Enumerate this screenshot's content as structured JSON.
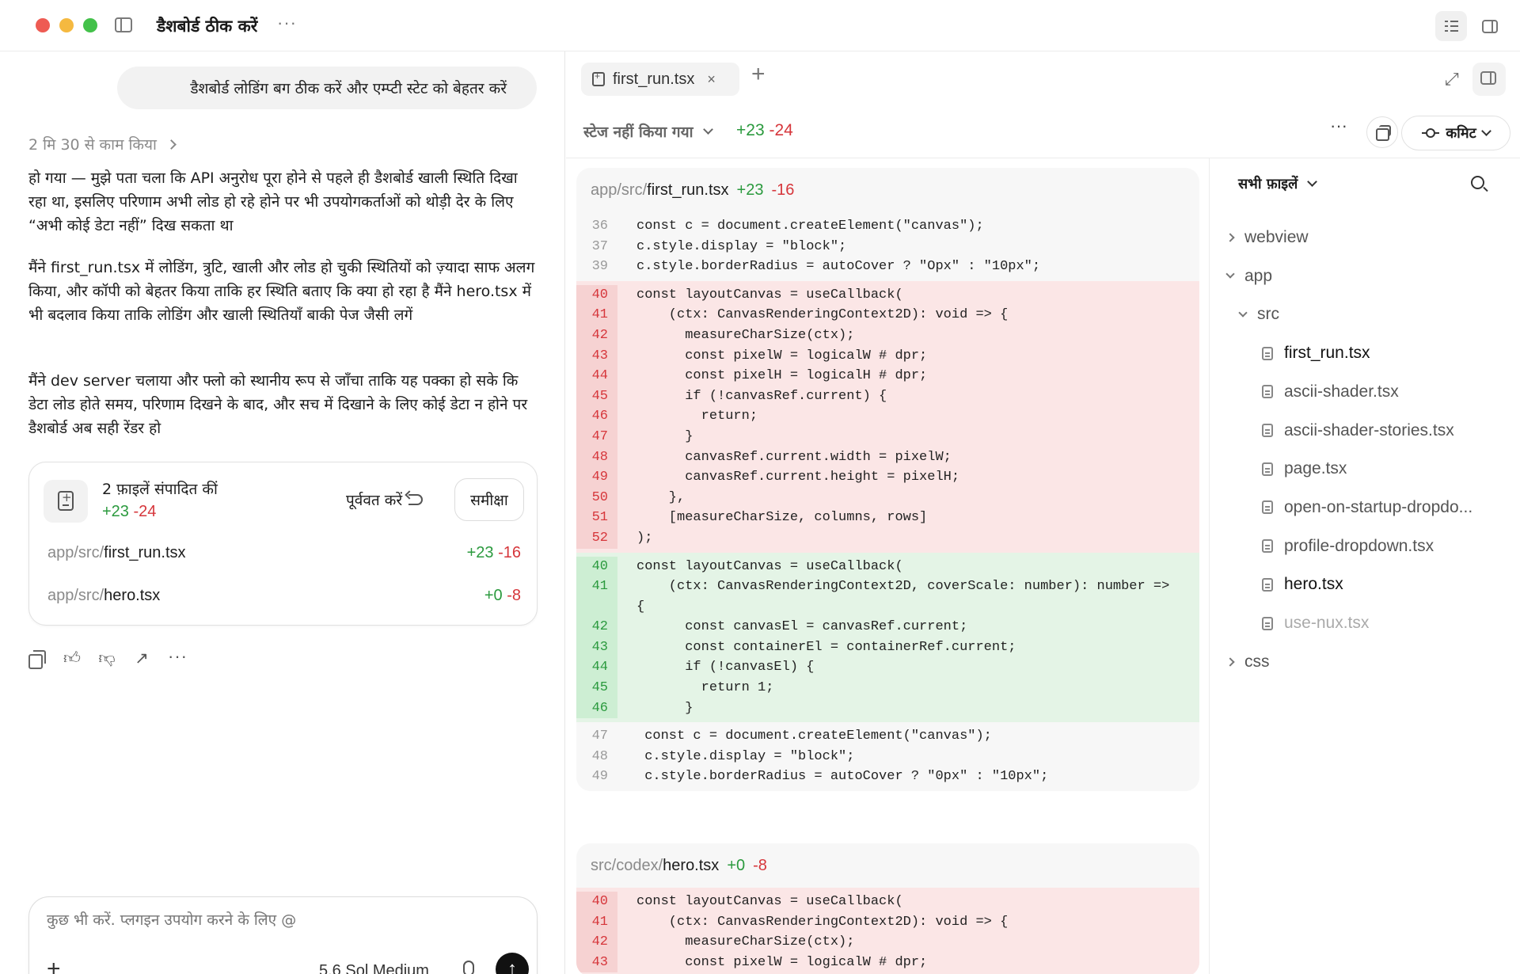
{
  "window": {
    "title": "डैशबोर्ड ठीक करें"
  },
  "chat": {
    "user_message": "डैशबोर्ड लोडिंग बग ठीक करें और एम्प्टी स्टेट को बेहतर करें",
    "worked_for": "2 मि 30 से काम किया",
    "paragraphs": [
      "हो गया — मुझे पता चला कि API अनुरोध पूरा होने से पहले ही डैशबोर्ड खाली स्थिति दिखा रहा था, इसलिए परिणाम अभी लोड हो रहे होने पर भी उपयोगकर्ताओं को थोड़ी देर के लिए “अभी कोई डेटा नहीं” दिख सकता था",
      "मैंने first_run.tsx में लोडिंग, त्रुटि, खाली और लोड हो चुकी स्थितियों को ज़्यादा साफ अलग किया, और कॉपी को बेहतर किया ताकि हर स्थिति बताए कि क्या हो रहा है मैंने hero.tsx में भी बदलाव किया ताकि लोडिंग और खाली स्थितियाँ बाकी पेज जैसी लगें",
      "मैंने dev server चलाया और फ्लो को स्थानीय रूप से जाँचा ताकि यह पक्का हो सके कि डेटा लोड होते समय, परिणाम दिखने के बाद, और सच में दिखाने के लिए कोई डेटा न होने पर डैशबोर्ड अब सही रेंडर हो"
    ],
    "files_card": {
      "title": "2 फ़ाइलें संपादित कीं",
      "added": "+23",
      "removed": "-24",
      "revert_label": "पूर्ववत करें",
      "review_label": "समीक्षा",
      "files": [
        {
          "dir": "app/src/",
          "name": "first_run.tsx",
          "added": "+23",
          "removed": "-16"
        },
        {
          "dir": "app/src/",
          "name": "hero.tsx",
          "added": "+0",
          "removed": "-8"
        }
      ]
    },
    "composer": {
      "placeholder": "कुछ भी करें. प्लगइन उपयोग करने के लिए @",
      "model": "5.6 Sol Medium",
      "send_icon": "arrow-up"
    }
  },
  "diff_pane": {
    "tab_label": "first_run.tsx",
    "unstaged_label": "स्टेज नहीं किया गया",
    "total_added": "+23",
    "total_removed": "-24",
    "commit_label": "कमिट",
    "files": [
      {
        "dir": "app/src/",
        "name": "first_run.tsx",
        "added": "+23",
        "removed": "-16",
        "hunks": [
          {
            "type": "ctx",
            "lines": [
              {
                "n": "36",
                "code": "const c = document.createElement(\"canvas\");"
              },
              {
                "n": "37",
                "code": "c.style.display = \"block\";"
              },
              {
                "n": "39",
                "code": "c.style.borderRadius = autoCover ? \"Opx\" : \"10px\";"
              }
            ]
          },
          {
            "type": "del",
            "lines": [
              {
                "n": "40",
                "code": "const layoutCanvas = useCallback("
              },
              {
                "n": "41",
                "code": "    (ctx: CanvasRenderingContext2D): void => {"
              },
              {
                "n": "42",
                "code": "      measureCharSize(ctx);"
              },
              {
                "n": "43",
                "code": "      const pixelW = logicalW # dpr;"
              },
              {
                "n": "44",
                "code": "      const pixelH = logicalH # dpr;"
              },
              {
                "n": "45",
                "code": "      if (!canvasRef.current) {"
              },
              {
                "n": "46",
                "code": "        return;"
              },
              {
                "n": "47",
                "code": "      }"
              },
              {
                "n": "48",
                "code": "      canvasRef.current.width = pixelW;"
              },
              {
                "n": "49",
                "code": "      canvasRef.current.height = pixelH;"
              },
              {
                "n": "50",
                "code": "    },"
              },
              {
                "n": "51",
                "code": "    [measureCharSize, columns, rows]"
              },
              {
                "n": "52",
                "code": ");"
              }
            ]
          },
          {
            "type": "add",
            "lines": [
              {
                "n": "40",
                "code": "const layoutCanvas = useCallback("
              },
              {
                "n": "41",
                "code": "    (ctx: CanvasRenderingContext2D, coverScale: number): number =>"
              },
              {
                "n": "",
                "code": "{"
              },
              {
                "n": "42",
                "code": "      const canvasEl = canvasRef.current;"
              },
              {
                "n": "43",
                "code": "      const containerEl = containerRef.current;"
              },
              {
                "n": "44",
                "code": "      if (!canvasEl) {"
              },
              {
                "n": "45",
                "code": "        return 1;"
              },
              {
                "n": "46",
                "code": "      }"
              }
            ]
          },
          {
            "type": "ctx",
            "lines": [
              {
                "n": "47",
                "code": " const c = document.createElement(\"canvas\");"
              },
              {
                "n": "48",
                "code": " c.style.display = \"block\";"
              },
              {
                "n": "49",
                "code": " c.style.borderRadius = autoCover ? \"0px\" : \"10px\";"
              }
            ]
          }
        ]
      },
      {
        "dir": "src/codex/",
        "name": "hero.tsx",
        "added": "+0",
        "removed": "-8",
        "hunks": [
          {
            "type": "del",
            "lines": [
              {
                "n": "40",
                "code": "const layoutCanvas = useCallback("
              },
              {
                "n": "41",
                "code": "    (ctx: CanvasRenderingContext2D): void => {"
              },
              {
                "n": "42",
                "code": "      measureCharSize(ctx);"
              },
              {
                "n": "43",
                "code": "      const pixelW = logicalW # dpr;"
              }
            ]
          }
        ]
      }
    ]
  },
  "file_tree": {
    "header": "सभी फ़ाइलें",
    "items": [
      {
        "label": "webview",
        "type": "dir-collapsed"
      },
      {
        "label": "app",
        "type": "dir-open"
      },
      {
        "label": "src",
        "type": "dir-open"
      },
      {
        "label": "first_run.tsx",
        "type": "file-selected"
      },
      {
        "label": "ascii-shader.tsx",
        "type": "file"
      },
      {
        "label": "ascii-shader-stories.tsx",
        "type": "file"
      },
      {
        "label": "page.tsx",
        "type": "file"
      },
      {
        "label": "open-on-startup-dropdo...",
        "type": "file"
      },
      {
        "label": "profile-dropdown.tsx",
        "type": "file"
      },
      {
        "label": "hero.tsx",
        "type": "file-selected"
      },
      {
        "label": "use-nux.tsx",
        "type": "file-faded"
      },
      {
        "label": "css",
        "type": "dir-collapsed"
      }
    ]
  }
}
